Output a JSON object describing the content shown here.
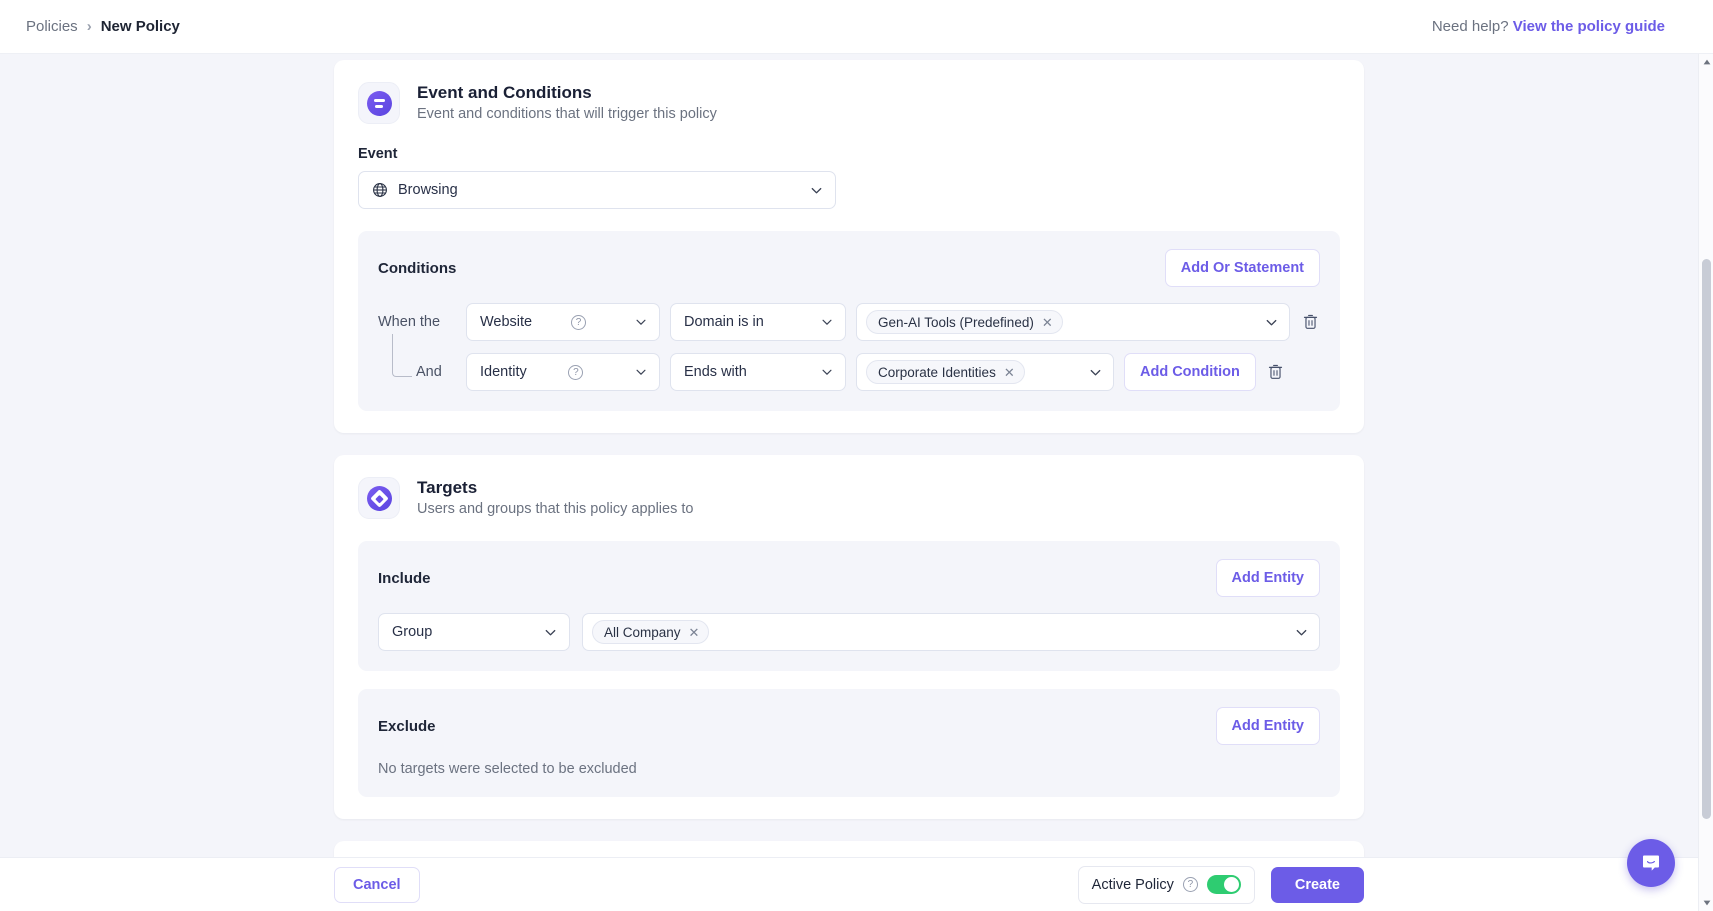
{
  "breadcrumb": {
    "root": "Policies",
    "separator": "›",
    "current": "New Policy"
  },
  "help": {
    "text": "Need help?",
    "link_label": "View the policy guide"
  },
  "event_card": {
    "icon": "sliders-circle-icon",
    "title": "Event and Conditions",
    "subtitle": "Event and conditions that will trigger this policy",
    "event_label": "Event",
    "event_value": "Browsing",
    "event_icon": "globe-icon",
    "conditions": {
      "title": "Conditions",
      "add_or_label": "Add Or Statement",
      "add_condition_label": "Add Condition",
      "rows": [
        {
          "prefix": "When the",
          "subject": "Website",
          "operator": "Domain is in",
          "tags": [
            "Gen-AI Tools (Predefined)"
          ],
          "has_help_icon": true,
          "has_delete": true
        },
        {
          "prefix": "And",
          "subject": "Identity",
          "operator": "Ends with",
          "tags": [
            "Corporate Identities"
          ],
          "has_help_icon": true,
          "has_delete": true
        }
      ]
    }
  },
  "targets_card": {
    "icon": "diamond-circle-icon",
    "title": "Targets",
    "subtitle": "Users and groups that this policy applies to",
    "include": {
      "title": "Include",
      "add_entity_label": "Add Entity",
      "entity_type": "Group",
      "tags": [
        "All Company"
      ]
    },
    "exclude": {
      "title": "Exclude",
      "add_entity_label": "Add Entity",
      "empty_text": "No targets were selected to be excluded"
    }
  },
  "footer": {
    "cancel_label": "Cancel",
    "active_policy_label": "Active Policy",
    "active_policy_enabled": true,
    "create_label": "Create"
  },
  "chat": {
    "icon": "chat-bubble-icon"
  },
  "colors": {
    "accent": "#6c5ce7",
    "toggle_on": "#2ecc71",
    "page_bg": "#f4f5fa",
    "card_bg": "#ffffff",
    "text": "#1f2638",
    "muted": "#6b7280"
  }
}
